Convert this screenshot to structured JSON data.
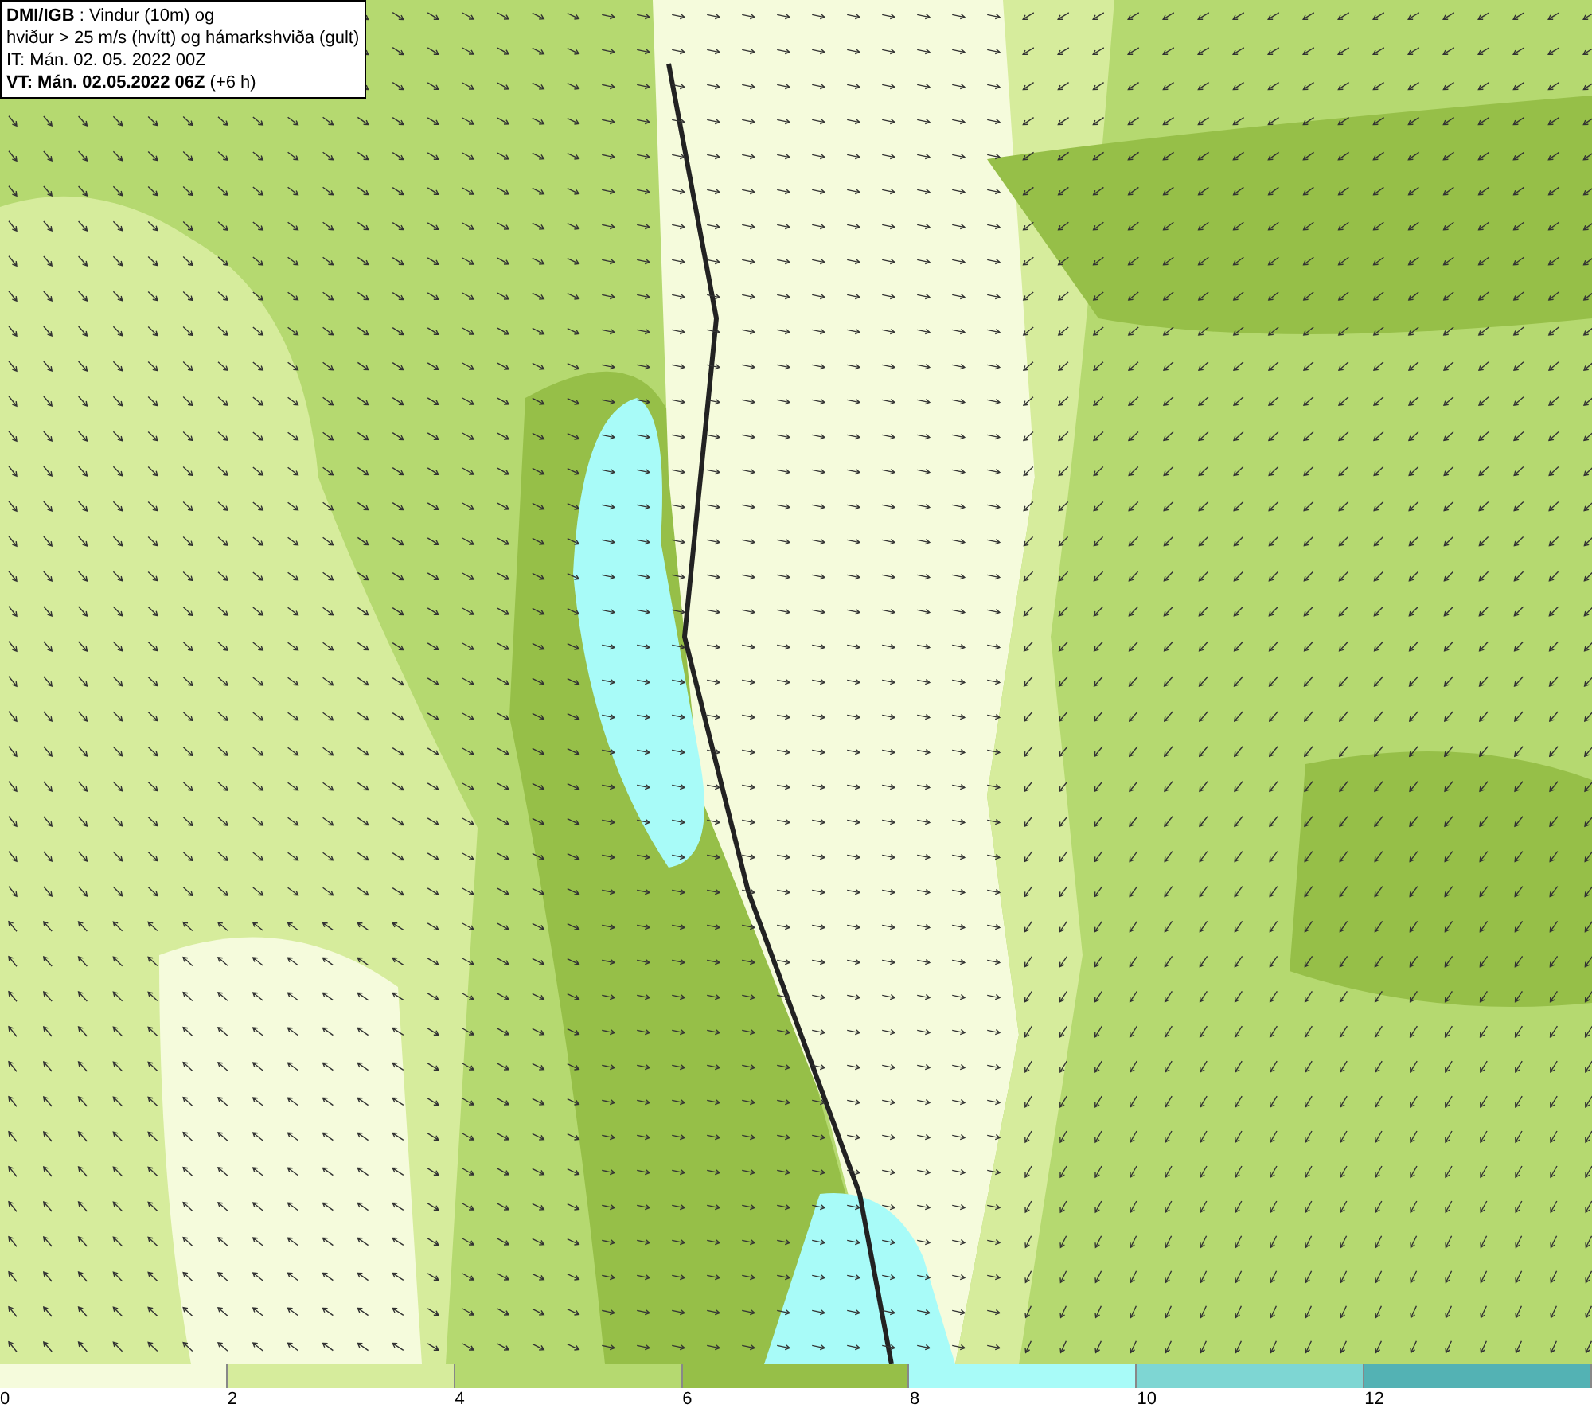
{
  "title_box": {
    "lines": [
      "**DMI/IGB** : Vindur (10m) og",
      "hviður > 25 m/s (hvítt) og hámarkshviða (gult)",
      "IT: Mán. 02. 05. 2022 00Z",
      "**VT: Mán. 02.05.2022 06Z** (+6 h)"
    ]
  },
  "legend": [
    {
      "label": "0",
      "color": "#f5fbdc"
    },
    {
      "label": "2",
      "color": "#d6ec9c"
    },
    {
      "label": "4",
      "color": "#b5d970"
    },
    {
      "label": "6",
      "color": "#96bf48"
    },
    {
      "label": "8",
      "color": "#a8fbf8"
    },
    {
      "label": "10",
      "color": "#7ed6d3"
    },
    {
      "label": "12",
      "color": "#53b2b4"
    }
  ]
}
